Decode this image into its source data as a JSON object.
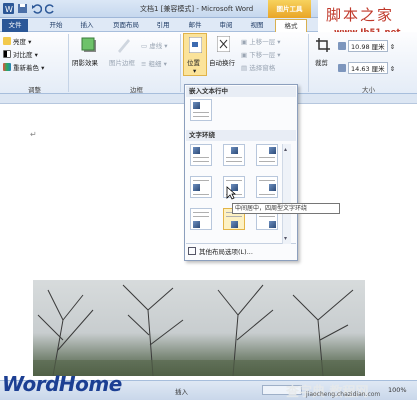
{
  "window": {
    "title": "文档1 [兼容模式] - Microsoft Word",
    "picture_tools": "图片工具"
  },
  "watermark": {
    "site_cn": "脚本之家",
    "site_url": "www.Jb51.net",
    "bottom_logo": "WordHome",
    "bottom_site": "查字典 教程网",
    "bottom_url": "jiaocheng.chazidian.com"
  },
  "tabs": [
    "文件",
    "开始",
    "插入",
    "页面布局",
    "引用",
    "邮件",
    "审阅",
    "视图",
    "格式"
  ],
  "ribbon": {
    "adjust": {
      "label": "调整",
      "brightness": "亮度",
      "contrast": "对比度",
      "recolor": "重新着色"
    },
    "shadow_effects": "阴影效果",
    "picture_border": "图片边框",
    "border": {
      "label": "边框",
      "dashes": "虚线",
      "weight": "粗细"
    },
    "position": "位置",
    "wrap_text": "自动换行",
    "arrange": {
      "bring_forward": "上移一层",
      "send_backward": "下移一层",
      "selection_pane": "选择窗格"
    },
    "crop": "裁剪",
    "size": {
      "label": "大小",
      "height": "10.98 厘米",
      "width": "14.63 厘米"
    }
  },
  "dropdown": {
    "inline_header": "嵌入文本行中",
    "wrap_header": "文字环绕",
    "tooltip": "中间居中，四周型文字环绕",
    "more_options": "其他布局选项(L)..."
  },
  "status": {
    "mode": "插入",
    "zoom": "100%"
  }
}
